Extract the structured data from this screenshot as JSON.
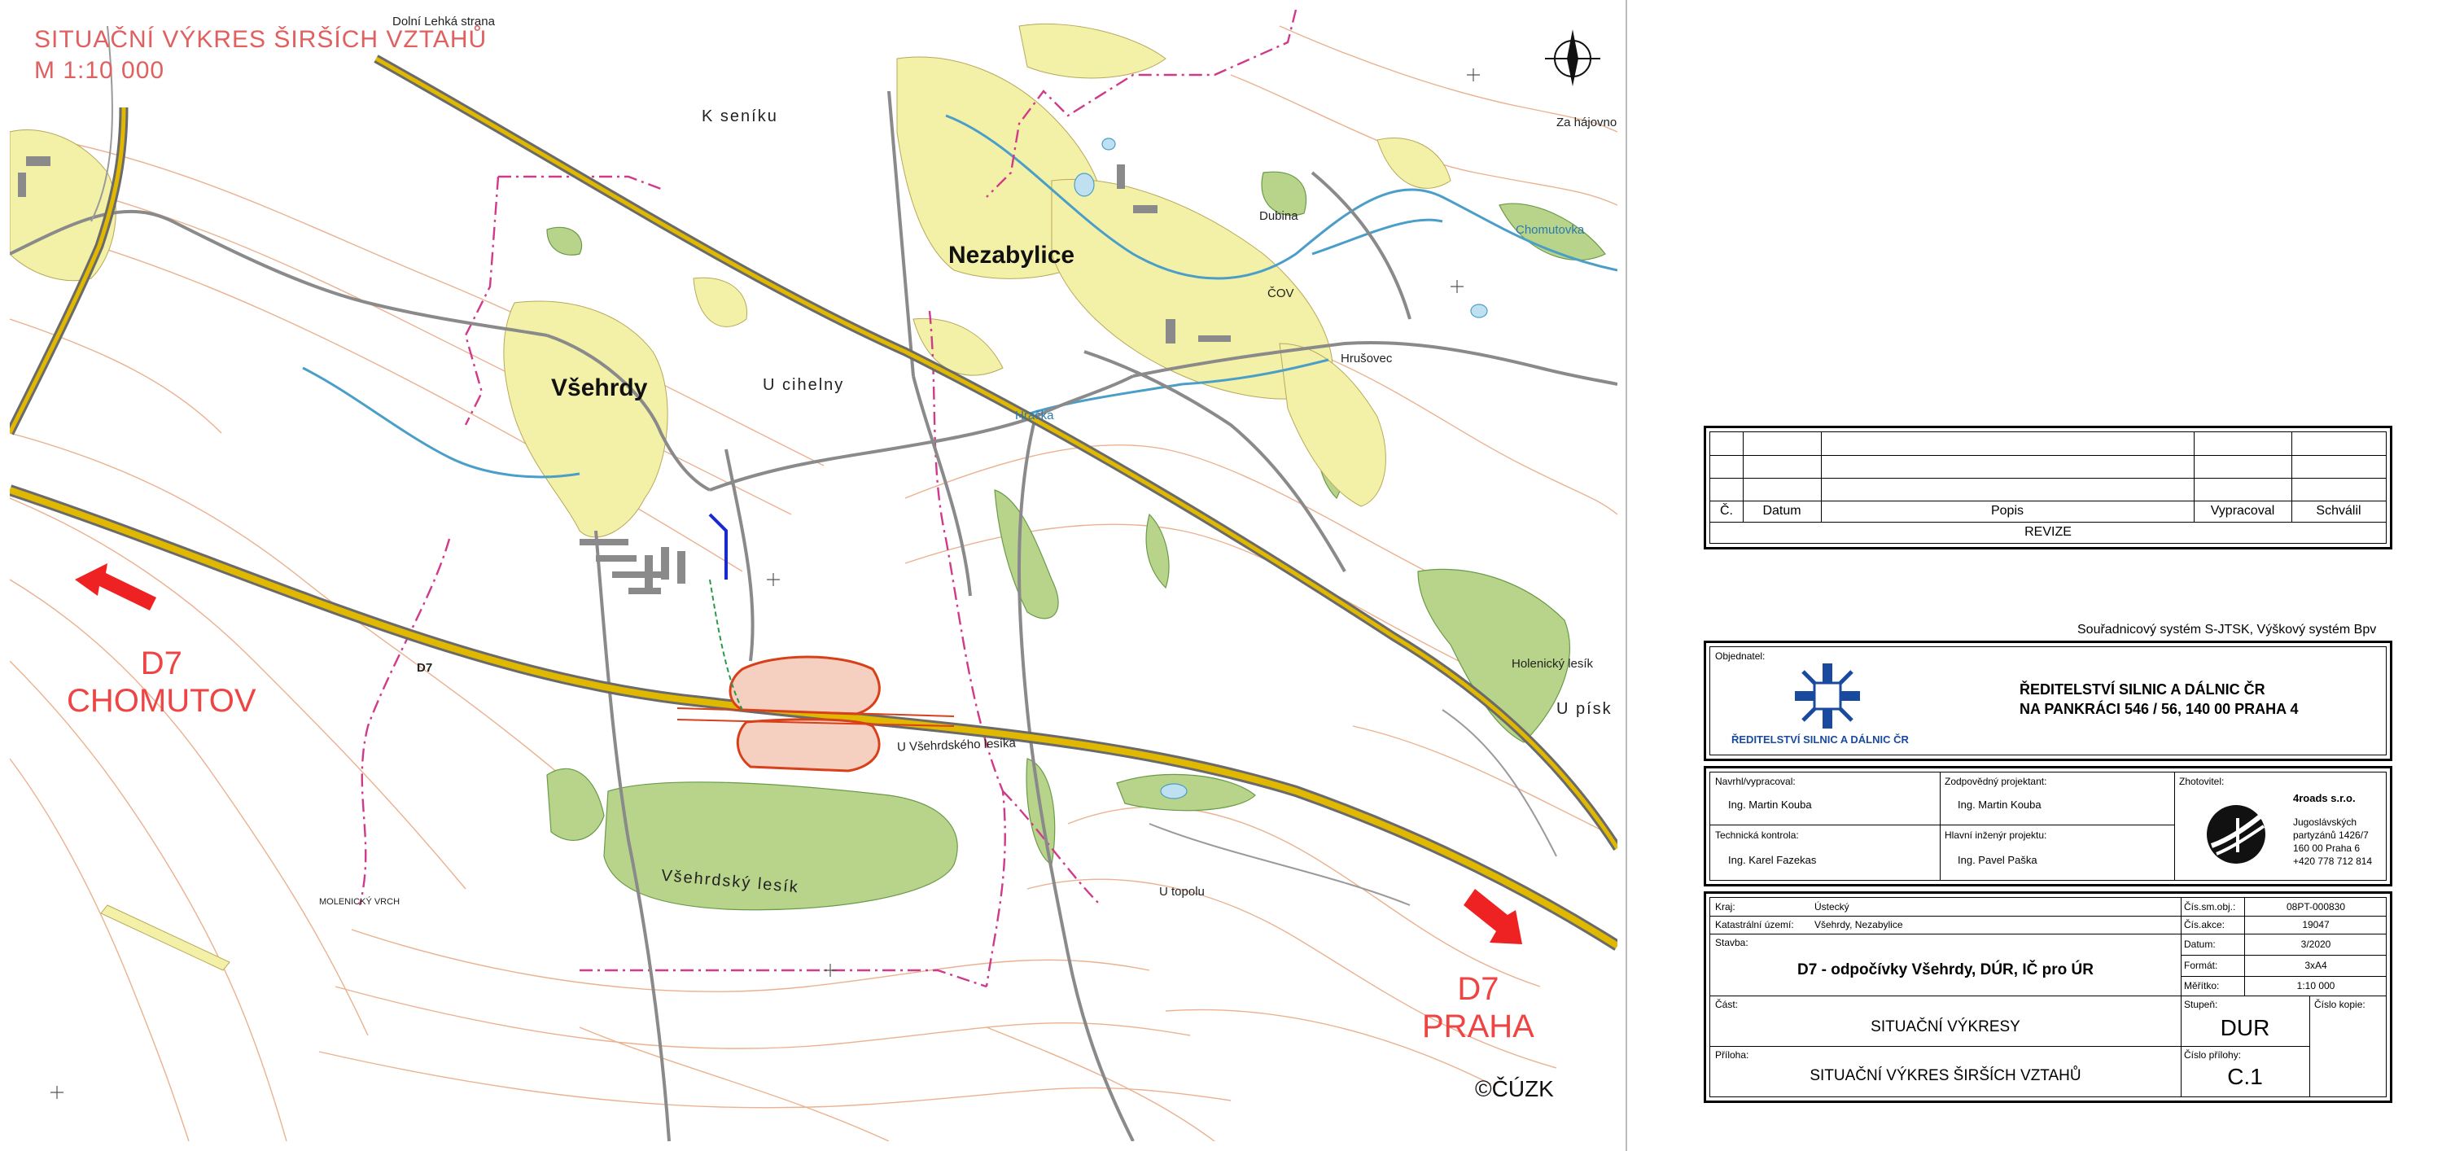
{
  "map": {
    "title": "SITUAČNÍ VÝKRES ŠIRŠÍCH VZTAHŮ",
    "scale": "M 1:10 000",
    "places": {
      "vsehrdy": "Všehrdy",
      "nezabylice": "Nezabylice",
      "k_seniku": "K seníku",
      "u_cihelny": "U cihelny",
      "dolni_lehka_strana": "Dolní Lehká strana",
      "za_hajovnou": "Za hájovnou",
      "dubina": "Dubina",
      "chomutovka": "Chomutovka",
      "hracka": "Hračka",
      "vsehrdsky_lesik": "Všehrdský lesík",
      "vsehrdsky_lesik_road": "U Všehrdského lesíka",
      "u_topolu": "U topolu",
      "holenicky_lesik": "Holenický lesík",
      "u_pisku": "U písk",
      "molenicky_vrch": "MOLENICKÝ VRCH",
      "hrusovec": "Hrušovec",
      "cov": "ČOV"
    },
    "road_label": "D7",
    "direction_left": {
      "line1": "D7",
      "line2": "CHOMUTOV"
    },
    "direction_right": {
      "line1": "D7",
      "line2": "PRAHA"
    },
    "copyright": "©ČÚZK",
    "colors": {
      "built_up": "#f3f0a8",
      "forest": "#b8d48a",
      "contour": "#e8a47c",
      "motorway": "#c9a400",
      "road": "#8a8a8a",
      "boundary": "#d03a8a",
      "water": "#4a9ec8",
      "red_arrow": "#ee2222",
      "project_outline": "#d8401a"
    }
  },
  "revisions": {
    "headers": {
      "no": "Č.",
      "date": "Datum",
      "desc": "Popis",
      "author": "Vypracoval",
      "approved": "Schválil"
    },
    "footer": "REVIZE"
  },
  "coords_system": "Souřadnicový systém S-JTSK, Výškový systém Bpv",
  "client": {
    "label": "Objednatel:",
    "logo_text": "ŘEDITELSTVÍ SILNIC A DÁLNIC ČR",
    "name_line1": "ŘEDITELSTVÍ SILNIC A DÁLNIC ČR",
    "name_line2": "NA PANKRÁCI 546 / 56, 140 00 PRAHA 4"
  },
  "people": {
    "designer_label": "Navrhl/vypracoval:",
    "designer": "Ing. Martin Kouba",
    "responsible_label": "Zodpovědný projektant:",
    "responsible": "Ing. Martin Kouba",
    "control_label": "Technická kontrola:",
    "control": "Ing. Karel Fazekas",
    "chief_label": "Hlavní inženýr projektu:",
    "chief": "Ing. Pavel Paška",
    "contractor_label": "Zhotovitel:",
    "contractor_name": "4roads s.r.o.",
    "contractor_addr1": "Jugoslávských",
    "contractor_addr2": "partyzánů 1426/7",
    "contractor_addr3": "160 00 Praha 6",
    "contractor_phone": "+420 778 712 814"
  },
  "info": {
    "kraj_label": "Kraj:",
    "kraj": "Ústecký",
    "katastr_label": "Katastrální území:",
    "katastr": "Všehrdy, Nezabylice",
    "stavba_label": "Stavba:",
    "stavba": "D7 - odpočívky Všehrdy, DÚR, IČ pro ÚR",
    "cast_label": "Část:",
    "cast": "SITUAČNÍ VÝKRESY",
    "priloha_label": "Příloha:",
    "priloha": "SITUAČNÍ VÝKRES ŠIRŠÍCH VZTAHŮ",
    "obj_label": "Čís.sm.obj.:",
    "obj": "08PT-000830",
    "akce_label": "Čís.akce:",
    "akce": "19047",
    "datum_label": "Datum:",
    "datum": "3/2020",
    "format_label": "Formát:",
    "format": "3xA4",
    "meritko_label": "Měřítko:",
    "meritko": "1:10 000",
    "stupen_label": "Stupeň:",
    "stupen": "DUR",
    "kopie_label": "Číslo kopie:",
    "cislo_prilohy_label": "Číslo přílohy:",
    "cislo_prilohy": "C.1"
  }
}
